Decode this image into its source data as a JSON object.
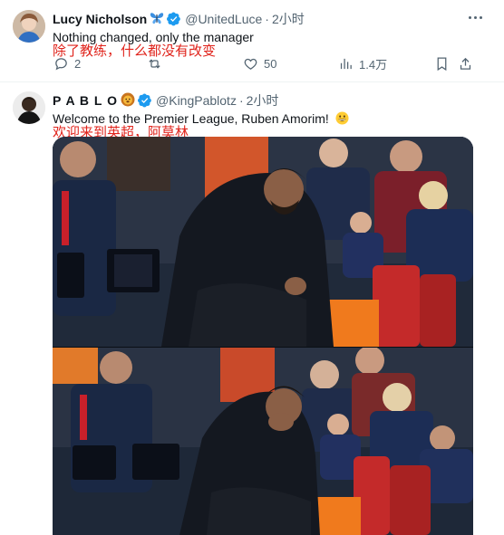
{
  "tweets": [
    {
      "name": "Lucy Nicholson",
      "name_emoji": "butterfly-emoji",
      "handle": "@UnitedLuce",
      "time": "2小时",
      "text": "Nothing changed, only the manager",
      "translation": "除了教练，什么都没有改变",
      "stats": {
        "replies": "2",
        "likes": "50",
        "views": "1.4万"
      }
    },
    {
      "name": "P A B L O",
      "name_emoji": "lion-emoji",
      "handle": "@KingPablotz",
      "time": "2小时",
      "text": "Welcome to the Premier League, Ruben Amorim!",
      "text_emoji": "grinning-emoji",
      "translation": "欢迎来到英超，阿莫林"
    }
  ],
  "colors": {
    "translation": "#e0231b",
    "verified": "#1d9bf0",
    "muted": "#536471"
  }
}
